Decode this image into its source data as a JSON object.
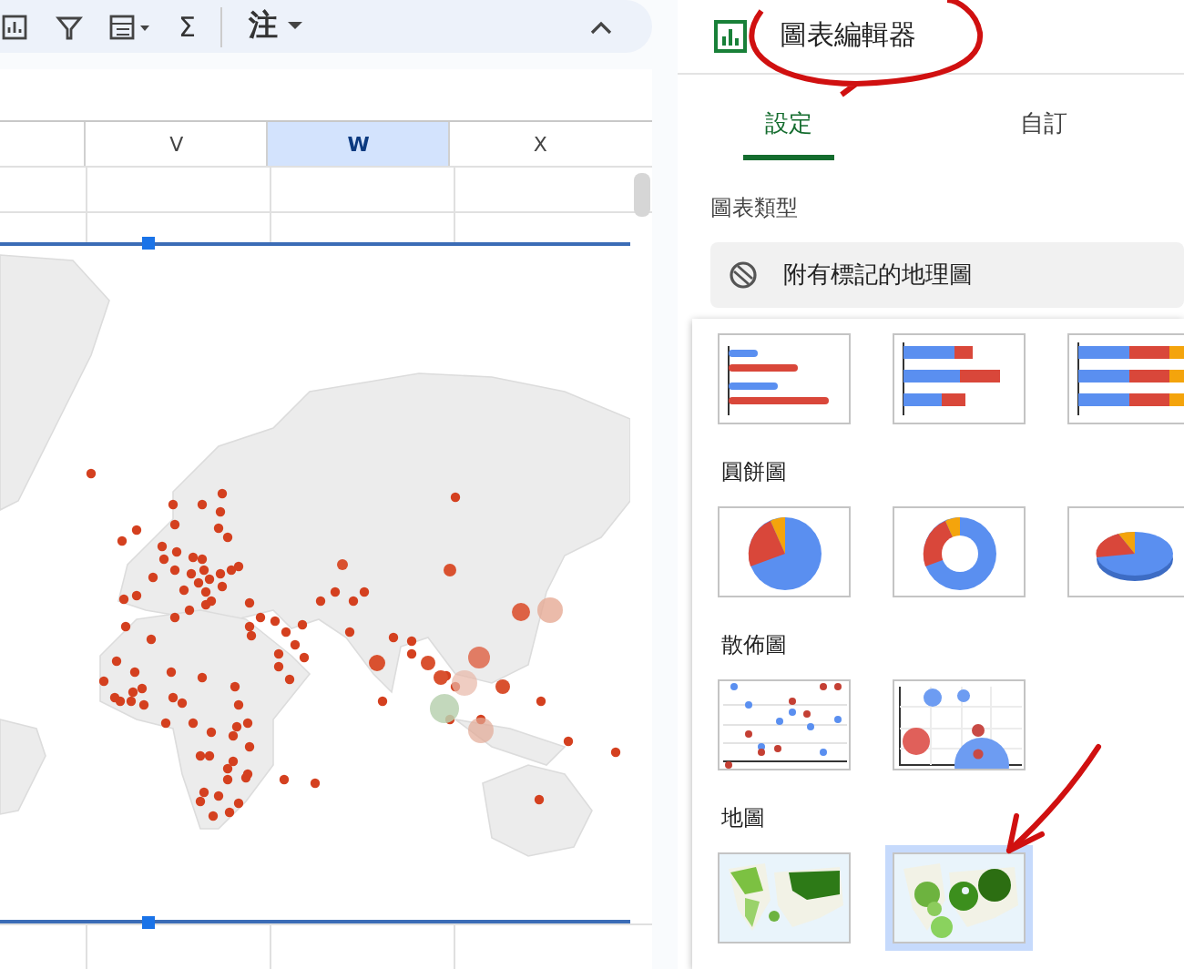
{
  "toolbar": {
    "sum_label": "Σ",
    "note_label": "注"
  },
  "columns": [
    {
      "label": "V",
      "selected": false
    },
    {
      "label": "W",
      "selected": true
    },
    {
      "label": "X",
      "selected": false
    }
  ],
  "chart_editor": {
    "title": "圖表編輯器",
    "tabs": [
      {
        "label": "設定",
        "selected": true
      },
      {
        "label": "自訂",
        "selected": false
      }
    ],
    "chart_type_label": "圖表類型",
    "chart_type_value": "附有標記的地理圖",
    "groups": [
      {
        "options": [
          {
            "kind": "bar",
            "selected": false
          },
          {
            "kind": "stacked-bar",
            "selected": false
          },
          {
            "kind": "stacked-bar-100",
            "selected": false
          }
        ]
      },
      {
        "title": "圓餅圖",
        "options": [
          {
            "kind": "pie",
            "selected": false
          },
          {
            "kind": "donut",
            "selected": false
          },
          {
            "kind": "pie-3d",
            "selected": false
          }
        ]
      },
      {
        "title": "散佈圖",
        "options": [
          {
            "kind": "scatter",
            "selected": false
          },
          {
            "kind": "bubble",
            "selected": false
          }
        ]
      },
      {
        "title": "地圖",
        "options": [
          {
            "kind": "geo-region",
            "selected": false
          },
          {
            "kind": "geo-marker",
            "selected": true
          }
        ]
      }
    ]
  }
}
